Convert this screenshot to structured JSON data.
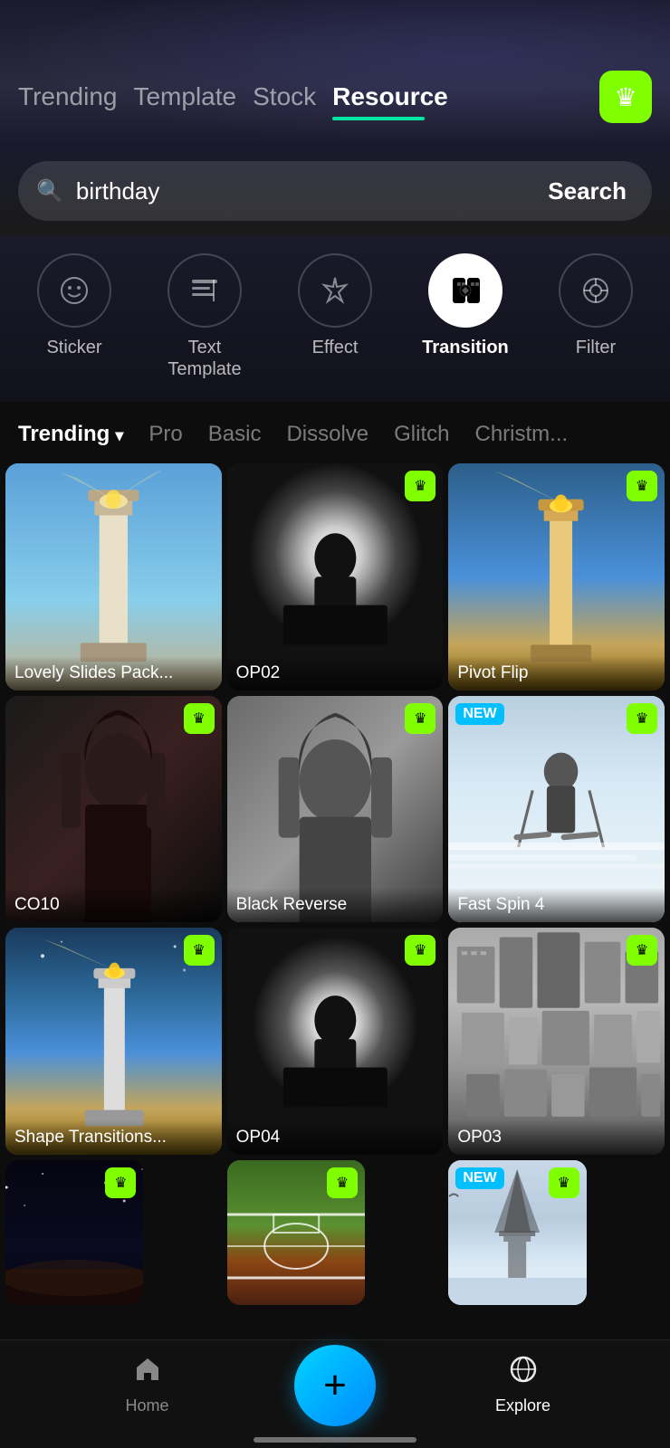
{
  "nav": {
    "tabs": [
      {
        "id": "trending",
        "label": "Trending",
        "active": false
      },
      {
        "id": "template",
        "label": "Template",
        "active": false
      },
      {
        "id": "stock",
        "label": "Stock",
        "active": false
      },
      {
        "id": "resource",
        "label": "Resource",
        "active": true
      }
    ],
    "crown_icon": "👑"
  },
  "search": {
    "placeholder": "birthday",
    "button_label": "Search",
    "icon": "🔍"
  },
  "categories": [
    {
      "id": "sticker",
      "label": "Sticker",
      "icon": "😊",
      "active": false
    },
    {
      "id": "text-template",
      "label": "Text\nTemplate",
      "icon": "T|",
      "active": false
    },
    {
      "id": "effect",
      "label": "Effect",
      "icon": "✳",
      "active": false
    },
    {
      "id": "transition",
      "label": "Transition",
      "icon": "▣",
      "active": true
    },
    {
      "id": "filter",
      "label": "Filter",
      "icon": "◎",
      "active": false
    }
  ],
  "filter_tabs": [
    {
      "id": "trending",
      "label": "Trending",
      "active": true,
      "has_dropdown": true
    },
    {
      "id": "pro",
      "label": "Pro",
      "active": false
    },
    {
      "id": "basic",
      "label": "Basic",
      "active": false
    },
    {
      "id": "dissolve",
      "label": "Dissolve",
      "active": false
    },
    {
      "id": "glitch",
      "label": "Glitch",
      "active": false
    },
    {
      "id": "christmas",
      "label": "Christm...",
      "active": false
    }
  ],
  "grid_items": [
    {
      "id": 1,
      "label": "Lovely Slides Pack...",
      "has_crown": false,
      "is_new": false,
      "thumb_class": "thumb-lighthouse-1"
    },
    {
      "id": 2,
      "label": "OP02",
      "has_crown": true,
      "is_new": false,
      "thumb_class": "thumb-silhouette-1"
    },
    {
      "id": 3,
      "label": "Pivot Flip",
      "has_crown": true,
      "is_new": false,
      "thumb_class": "thumb-lighthouse-2"
    },
    {
      "id": 4,
      "label": "CO10",
      "has_crown": true,
      "is_new": false,
      "thumb_class": "thumb-woman-dark"
    },
    {
      "id": 5,
      "label": "Black Reverse",
      "has_crown": true,
      "is_new": false,
      "thumb_class": "thumb-woman-light"
    },
    {
      "id": 6,
      "label": "Fast Spin 4",
      "has_crown": true,
      "is_new": true,
      "thumb_class": "thumb-ski"
    },
    {
      "id": 7,
      "label": "Shape Transitions...",
      "has_crown": true,
      "is_new": false,
      "thumb_class": "thumb-lighthouse-3"
    },
    {
      "id": 8,
      "label": "OP04",
      "has_crown": true,
      "is_new": false,
      "thumb_class": "thumb-silhouette-2"
    },
    {
      "id": 9,
      "label": "OP03",
      "has_crown": true,
      "is_new": false,
      "thumb_class": "thumb-city"
    },
    {
      "id": 10,
      "label": "",
      "has_crown": true,
      "is_new": false,
      "thumb_class": "thumb-dark-sky"
    },
    {
      "id": 11,
      "label": "",
      "has_crown": true,
      "is_new": false,
      "thumb_class": "thumb-field"
    },
    {
      "id": 12,
      "label": "",
      "has_crown": true,
      "is_new": true,
      "thumb_class": "thumb-city-light"
    }
  ],
  "bottom_nav": {
    "items": [
      {
        "id": "home",
        "label": "Home",
        "icon": "⌂",
        "active": false
      },
      {
        "id": "explore",
        "label": "Explore",
        "icon": "🪐",
        "active": true
      }
    ],
    "add_icon": "+"
  },
  "badges": {
    "crown_icon": "♛",
    "new_label": "NEW"
  }
}
